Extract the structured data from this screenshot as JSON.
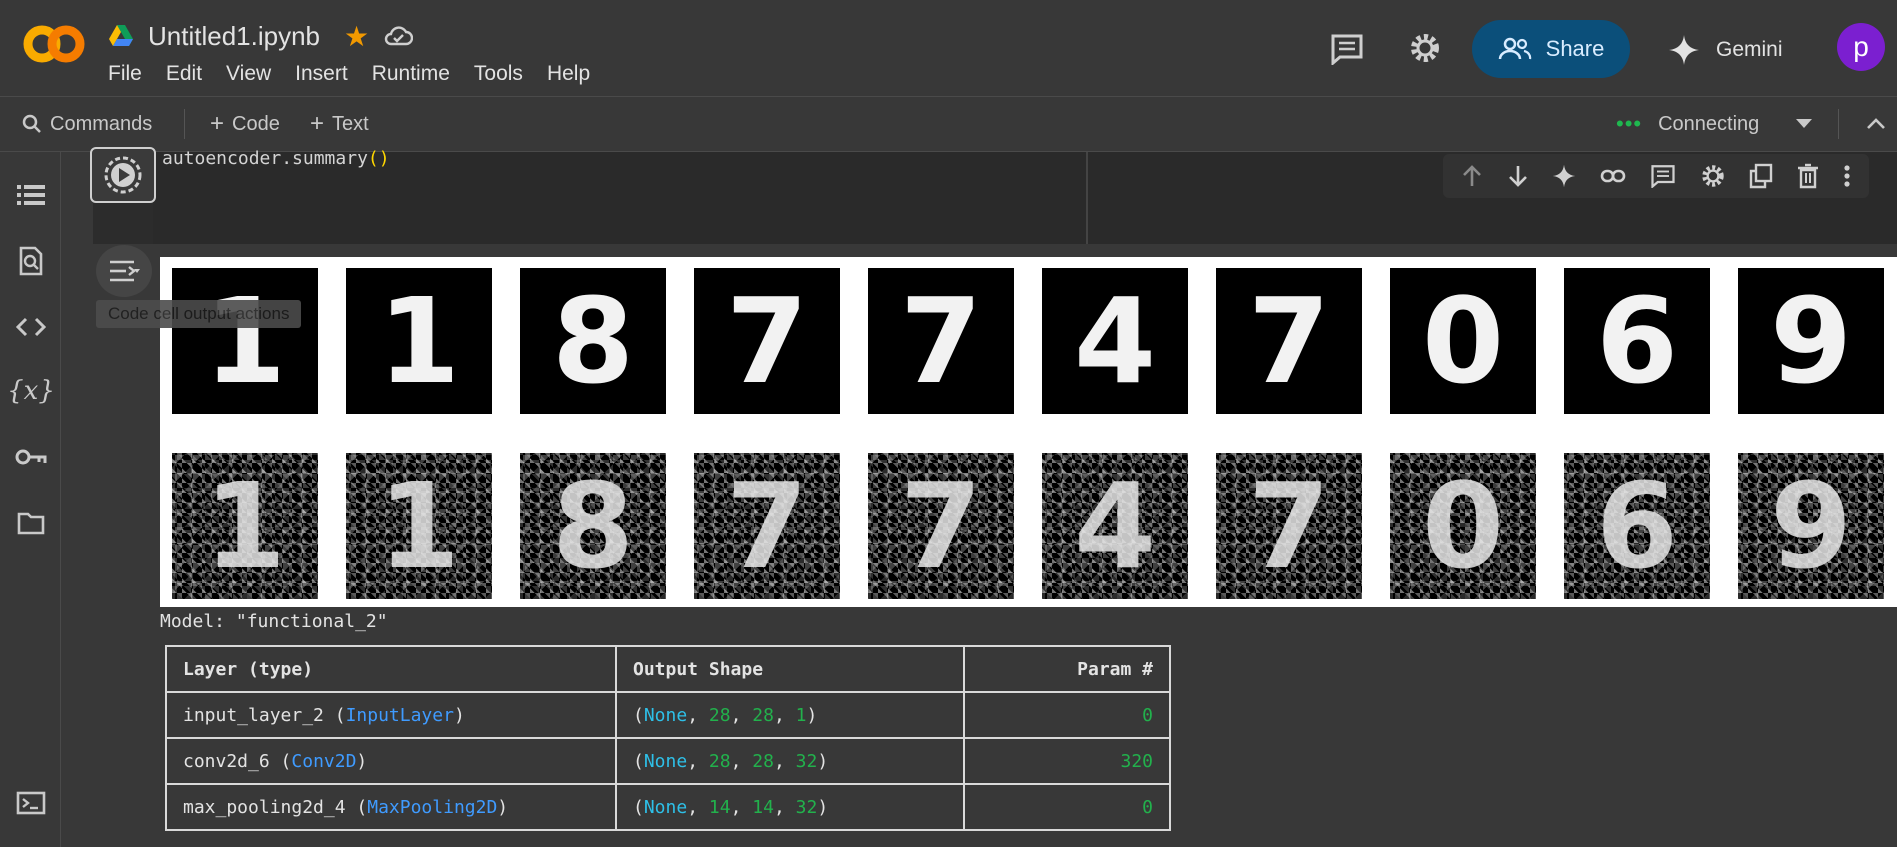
{
  "header": {
    "logo_text": "CO",
    "doc_title": "Untitled1.ipynb",
    "menu": [
      "File",
      "Edit",
      "View",
      "Insert",
      "Runtime",
      "Tools",
      "Help"
    ],
    "share_label": "Share",
    "gemini_label": "Gemini",
    "avatar_letter": "p",
    "colors": {
      "share_bg": "#0b4f7a",
      "avatar_bg": "#7b1fd0",
      "star": "#f29900",
      "logo_orange": "#f9ab00"
    }
  },
  "toolbar": {
    "commands_label": "Commands",
    "code_label": "Code",
    "text_label": "Text",
    "status_label": "Connecting",
    "status_dots": "•••"
  },
  "rail": {
    "icons": [
      "table-of-contents-icon",
      "find-replace-icon",
      "code-snippets-icon",
      "variables-icon",
      "secrets-key-icon",
      "files-folder-icon",
      "terminal-icon"
    ]
  },
  "cell": {
    "code_text": "autoencoder.summary",
    "code_parens": "()",
    "toolbar_icons": [
      "move-up-icon",
      "move-down-icon",
      "gemini-sparkle-icon",
      "link-icon",
      "comment-icon",
      "settings-icon",
      "mirror-cell-icon",
      "delete-icon",
      "more-icon"
    ],
    "output_tooltip": "Code cell output actions"
  },
  "images": {
    "original_digits": [
      "1",
      "1",
      "8",
      "7",
      "7",
      "4",
      "7",
      "0",
      "6",
      "9"
    ],
    "noisy_digits": [
      "1",
      "1",
      "8",
      "7",
      "7",
      "4",
      "7",
      "0",
      "6",
      "9"
    ]
  },
  "summary": {
    "model_title": "Model: \"functional_2\"",
    "headers": [
      "Layer (type)",
      "Output Shape",
      "Param #"
    ],
    "rows": [
      {
        "name": "input_layer_2",
        "type": "InputLayer",
        "shape": [
          "None",
          "28",
          "28",
          "1"
        ],
        "params": "0"
      },
      {
        "name": "conv2d_6",
        "type": "Conv2D",
        "shape": [
          "None",
          "28",
          "28",
          "32"
        ],
        "params": "320"
      },
      {
        "name": "max_pooling2d_4",
        "type": "MaxPooling2D",
        "shape": [
          "None",
          "14",
          "14",
          "32"
        ],
        "params": "0"
      }
    ]
  }
}
